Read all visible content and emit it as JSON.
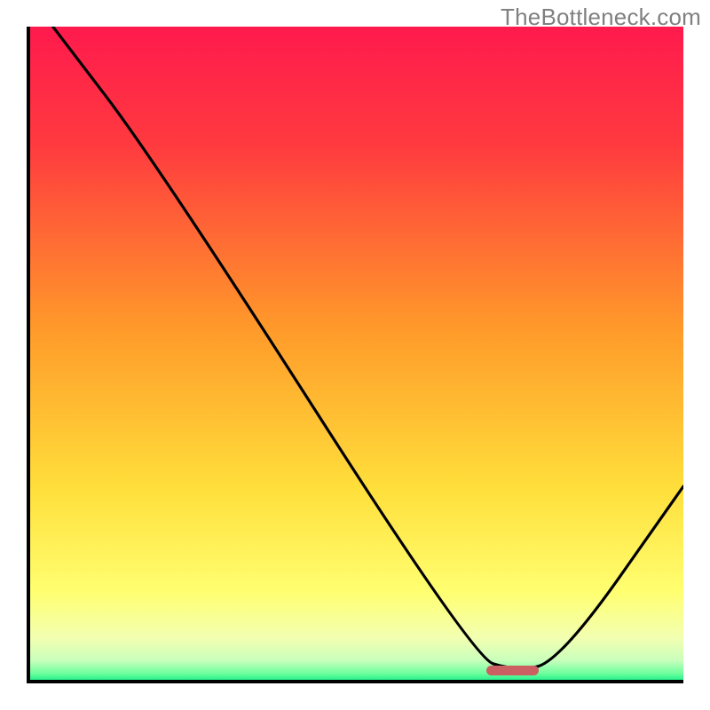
{
  "watermark": "TheBottleneck.com",
  "chart_data": {
    "type": "line",
    "title": "",
    "xlabel": "",
    "ylabel": "",
    "xlim": [
      0,
      100
    ],
    "ylim": [
      0,
      100
    ],
    "x": [
      4,
      20,
      68,
      74,
      81,
      100
    ],
    "y": [
      100,
      79,
      4,
      2,
      3,
      30
    ],
    "annotations": [],
    "marker": {
      "x_start": 70,
      "x_end": 78,
      "y": 2,
      "color": "#cb5f62"
    },
    "background_gradient": {
      "stops": [
        {
          "offset": 0,
          "color": "#ff1a4d"
        },
        {
          "offset": 18,
          "color": "#ff3a3f"
        },
        {
          "offset": 46,
          "color": "#ff9a2a"
        },
        {
          "offset": 70,
          "color": "#ffde3a"
        },
        {
          "offset": 86,
          "color": "#ffff70"
        },
        {
          "offset": 93,
          "color": "#f3ffb0"
        },
        {
          "offset": 96.5,
          "color": "#c9ffbc"
        },
        {
          "offset": 98.5,
          "color": "#6dff9d"
        },
        {
          "offset": 100,
          "color": "#00e884"
        }
      ]
    }
  }
}
